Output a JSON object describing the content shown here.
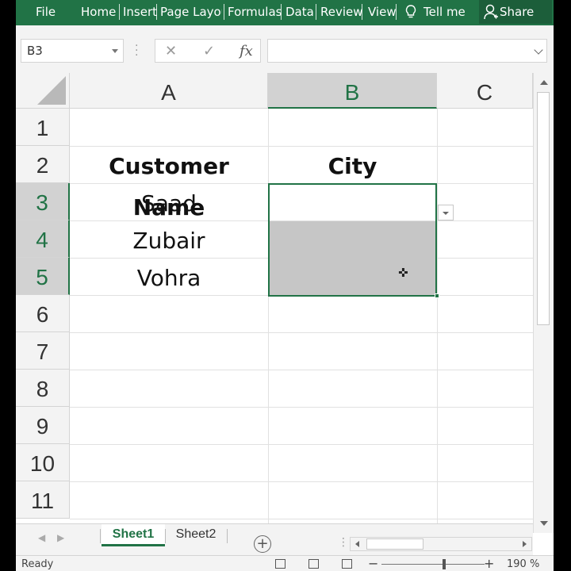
{
  "ribbon": {
    "tabs": [
      "File",
      "Home",
      "Insert",
      "Page Layout",
      "Formulas",
      "Data",
      "Review",
      "View"
    ],
    "tell_me": "Tell me",
    "share": "Share"
  },
  "formula_bar": {
    "name_box": "B3",
    "cancel_icon": "✕",
    "enter_icon": "✓",
    "fx_label": "fx",
    "formula": ""
  },
  "sheet": {
    "columns": [
      "A",
      "B",
      "C"
    ],
    "rows": [
      "1",
      "2",
      "3",
      "4",
      "5",
      "6",
      "7",
      "8",
      "9",
      "10",
      "11"
    ],
    "cells": {
      "A2": "Customer Name",
      "B2": "City",
      "A3": "Saad",
      "A4": "Zubair",
      "A5": "Vohra"
    },
    "selected_cell": "B3",
    "selected_range": "B3:B5"
  },
  "tabs": {
    "sheets": [
      "Sheet1",
      "Sheet2"
    ],
    "active": "Sheet1"
  },
  "status": {
    "mode": "Ready",
    "zoom": "190 %"
  },
  "colors": {
    "accent": "#217346",
    "selection_fill": "#c6c6c6"
  }
}
